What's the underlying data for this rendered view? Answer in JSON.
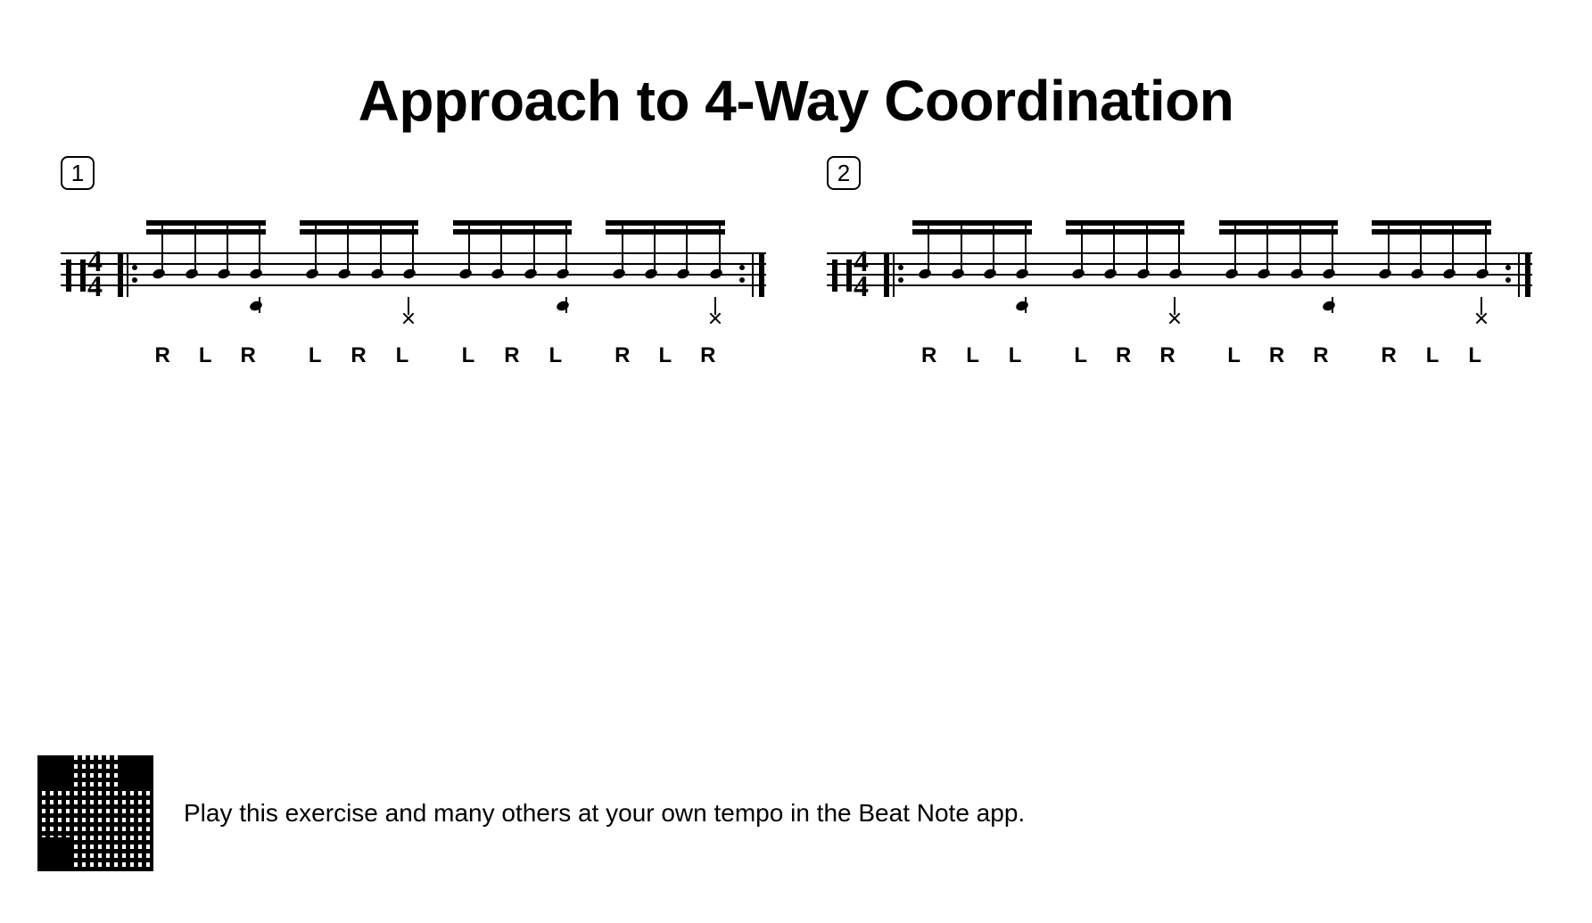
{
  "title": "Approach to 4-Way Coordination",
  "time_signature": {
    "top": "4",
    "bottom": "4"
  },
  "exercises": [
    {
      "number": "1",
      "sticking": [
        [
          "R",
          "L",
          "R"
        ],
        [
          "L",
          "R",
          "L"
        ],
        [
          "L",
          "R",
          "L"
        ],
        [
          "R",
          "L",
          "R"
        ]
      ],
      "hihat_on_beats": [
        2,
        4
      ]
    },
    {
      "number": "2",
      "sticking": [
        [
          "R",
          "L",
          "L"
        ],
        [
          "L",
          "R",
          "R"
        ],
        [
          "L",
          "R",
          "R"
        ],
        [
          "R",
          "L",
          "L"
        ]
      ],
      "hihat_on_beats": [
        2,
        4
      ]
    }
  ],
  "footer_text": "Play this exercise and many others at your own tempo in the Beat Note app."
}
